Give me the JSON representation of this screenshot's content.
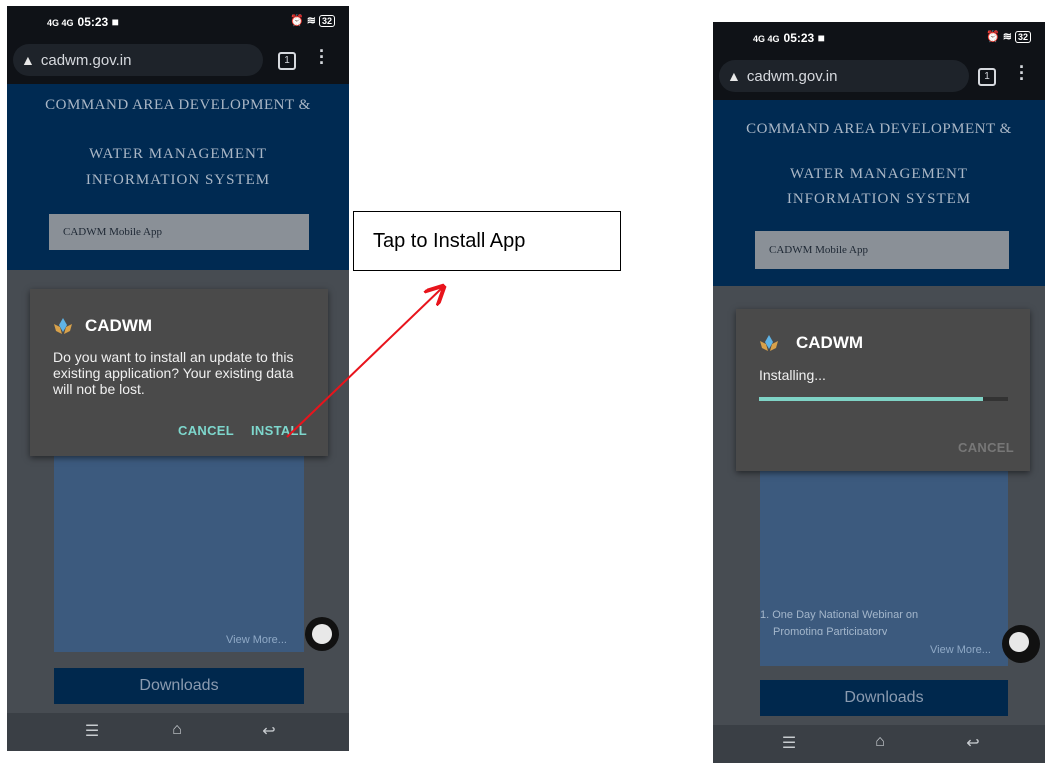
{
  "left_phone": {
    "status": {
      "time": "05:23",
      "signal": "4G 4G",
      "battery": "32"
    },
    "browser": {
      "url": "cadwm.gov.in",
      "tab_count": "1"
    },
    "site": {
      "title_line1": "COMMAND AREA DEVELOPMENT &",
      "title_line2": "WATER MANAGEMENT",
      "title_line3": "INFORMATION SYSTEM",
      "app_box_label": "CADWM Mobile App",
      "view_more": "View More...",
      "downloads": "Downloads"
    },
    "dialog": {
      "title": "CADWM",
      "message": "Do you want to install an update to this existing application? Your existing data will not be lost.",
      "cancel_label": "CANCEL",
      "install_label": "INSTALL"
    }
  },
  "callout": {
    "text": "Tap to Install App",
    "arrow_color": "#e8141c"
  },
  "right_phone": {
    "status": {
      "time": "05:23",
      "signal": "4G 4G",
      "battery": "32"
    },
    "browser": {
      "url": "cadwm.gov.in",
      "tab_count": "1"
    },
    "site": {
      "title_line1": "COMMAND AREA DEVELOPMENT &",
      "title_line2": "WATER MANAGEMENT",
      "title_line3": "INFORMATION SYSTEM",
      "app_box_label": "CADWM Mobile App",
      "news_item": "1.  One Day National Webinar on",
      "news_item_cut": "Promoting Participatory",
      "view_more": "View More...",
      "downloads": "Downloads"
    },
    "dialog": {
      "title": "CADWM",
      "status": "Installing...",
      "progress_fraction": 0.9,
      "cancel_label": "CANCEL"
    }
  },
  "colors": {
    "accent": "#7ed7cd",
    "site_header": "#002a52",
    "dialog_bg": "#4a4a4a"
  }
}
